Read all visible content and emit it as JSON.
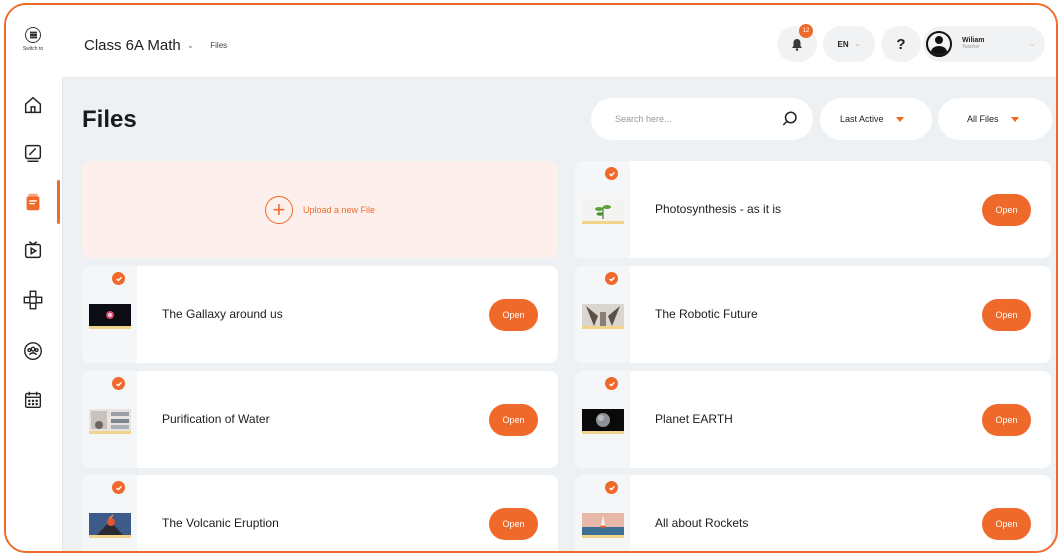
{
  "sidebar": {
    "switch_label": "Switch to",
    "items": [
      {
        "icon": "home-icon"
      },
      {
        "icon": "whiteboard-icon"
      },
      {
        "icon": "files-icon",
        "active": true
      },
      {
        "icon": "video-icon"
      },
      {
        "icon": "gamepad-icon"
      },
      {
        "icon": "group-icon"
      },
      {
        "icon": "calendar-icon"
      }
    ]
  },
  "header": {
    "class_name": "Class 6A Math",
    "breadcrumb": "Files",
    "notification_count": "12",
    "language": "EN",
    "help": "?",
    "user_name": "Wiliam",
    "user_role": "Teacher"
  },
  "main": {
    "title": "Files",
    "search_placeholder": "Search here...",
    "sort_label": "Last Active",
    "filter_label": "All Files",
    "upload_label": "Upload a new File",
    "open_label": "Open",
    "files": [
      {
        "title": "Photosynthesis - as it is",
        "thumb": "plant-thumbnail"
      },
      {
        "title": "The Gallaxy around us",
        "thumb": "galaxy-thumbnail"
      },
      {
        "title": "The Robotic Future",
        "thumb": "robot-thumbnail"
      },
      {
        "title": "Purification of Water",
        "thumb": "water-thumbnail"
      },
      {
        "title": "Planet EARTH",
        "thumb": "earth-thumbnail"
      },
      {
        "title": "The Volcanic Eruption",
        "thumb": "volcano-thumbnail"
      },
      {
        "title": "All about Rockets",
        "thumb": "rocket-thumbnail"
      }
    ]
  },
  "colors": {
    "accent": "#ef6a2a",
    "upload_bg": "#fdf0ec",
    "page_bg": "#eef1f4"
  }
}
